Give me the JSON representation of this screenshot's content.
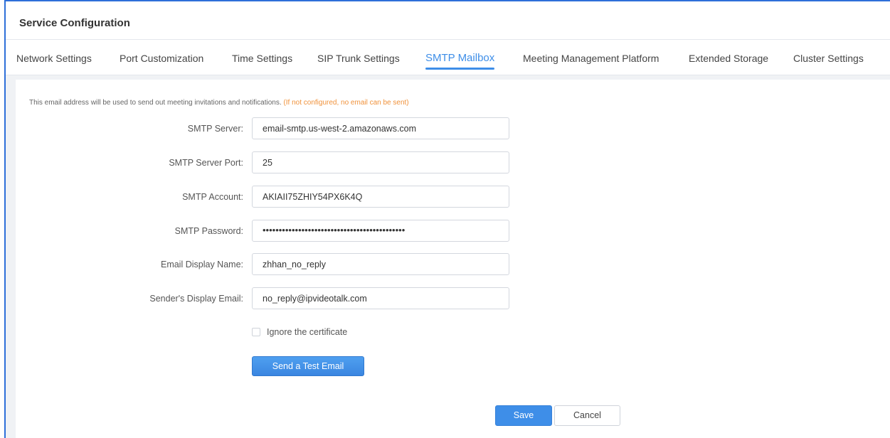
{
  "header": {
    "title": "Service Configuration"
  },
  "tabs": [
    {
      "label": "Network Settings"
    },
    {
      "label": "Port Customization"
    },
    {
      "label": "Time Settings"
    },
    {
      "label": "SIP Trunk Settings"
    },
    {
      "label": "SMTP Mailbox",
      "active": true
    },
    {
      "label": "Meeting Management Platform"
    },
    {
      "label": "Extended Storage"
    },
    {
      "label": "Cluster Settings"
    }
  ],
  "notice": {
    "text": "This email address will be used to send out meeting invitations and notifications. ",
    "warning": "(If not configured, no email can be sent)"
  },
  "form": {
    "smtp_server": {
      "label": "SMTP Server:",
      "value": "email-smtp.us-west-2.amazonaws.com"
    },
    "smtp_port": {
      "label": "SMTP Server Port:",
      "value": "25"
    },
    "smtp_account": {
      "label": "SMTP Account:",
      "value": "AKIAII75ZHIY54PX6K4Q"
    },
    "smtp_password": {
      "label": "SMTP Password:",
      "value": "••••••••••••••••••••••••••••••••••••••••••••"
    },
    "display_name": {
      "label": "Email Display Name:",
      "value": "zhhan_no_reply"
    },
    "sender_email": {
      "label": "Sender's Display Email:",
      "value": "no_reply@ipvideotalk.com"
    },
    "ignore_certificate": {
      "label": "Ignore the certificate",
      "checked": false
    }
  },
  "buttons": {
    "test_email": "Send a Test Email",
    "save": "Save",
    "cancel": "Cancel"
  },
  "colors": {
    "accent": "#3e8ee8",
    "warning": "#f0923b",
    "frame_border": "#2e6fd9"
  }
}
